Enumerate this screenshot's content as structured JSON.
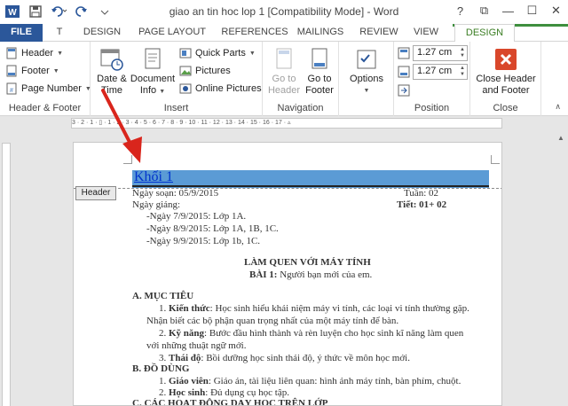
{
  "window": {
    "title": "giao an tin hoc lop 1 [Compatibility Mode] - Word",
    "help": "?",
    "restore": "⧉",
    "minimize": "—",
    "maximize": "☐",
    "close": "✕"
  },
  "tabs": {
    "file": "FILE",
    "t": "T",
    "design": "DESIGN",
    "page_layout": "PAGE LAYOUT",
    "references": "REFERENCES",
    "mailings": "MAILINGS",
    "review": "REVIEW",
    "view": "VIEW",
    "hf_design": "DESIGN"
  },
  "ribbon": {
    "header_footer": {
      "header": "Header",
      "footer": "Footer",
      "page_number": "Page Number",
      "label": "Header & Footer"
    },
    "insert": {
      "date_time_1": "Date &",
      "date_time_2": "Time",
      "doc_info_1": "Document",
      "doc_info_2": "Info",
      "quick_parts": "Quick Parts",
      "pictures": "Pictures",
      "online_pictures": "Online Pictures",
      "label": "Insert"
    },
    "navigation": {
      "goto_header_1": "Go to",
      "goto_header_2": "Header",
      "goto_footer_1": "Go to",
      "goto_footer_2": "Footer",
      "label": "Navigation"
    },
    "options": {
      "options": "Options"
    },
    "position": {
      "header_pos": "1.27 cm",
      "footer_pos": "1.27 cm",
      "label": "Position"
    },
    "close": {
      "close_1": "Close Header",
      "close_2": "and Footer",
      "label": "Close"
    }
  },
  "ruler": {
    "ticks": "3 · 2 · 1 · ▯ · 1 · 2 · 3 · 4 · 5 · 6 · 7 · 8 · 9 · 10 · 11 · 12 · 13 · 14 · 15 · 16 · 17 · ▵"
  },
  "doc": {
    "header_text": "Khối 1",
    "header_tag": "Header",
    "ngay_soan": "Ngày soạn: 05/9/2015",
    "tuan": "Tuần: 02",
    "ngay_giang": "Ngày giảng:",
    "tiet": "Tiết: 01+ 02",
    "ngay1": "-Ngày 7/9/2015: Lớp 1A.",
    "ngay2": "-Ngày 8/9/2015: Lớp 1A, 1B, 1C.",
    "ngay3": "-Ngày 9/9/2015: Lớp 1b, 1C.",
    "lam_quen": "LÀM QUEN VỚI MÁY TÍNH",
    "bai1_label": "BÀI 1:",
    "bai1_text": " Người bạn mới của em.",
    "a_muc_tieu": "A. MỤC TIÊU",
    "kt_num": "1.",
    "kt_label": "Kiến thức",
    "kt_text": ": Học sinh hiểu khái niệm máy vi tính, các loại vi tính thường gặp.",
    "kt_text2": "Nhận biết các bộ phận quan trọng nhất của một máy tính để bàn.",
    "kn_num": "2.",
    "kn_label": "Kỹ năng",
    "kn_text": ": Bước đầu hình thành và rèn luyện cho học sinh kĩ năng làm quen",
    "kn_text2": "với những thuật ngữ mới.",
    "td_num": "3.",
    "td_label": "Thái độ",
    "td_text": ": Bồi dưỡng học sinh thái độ, ý thức về môn học mới.",
    "b_do_dung": "B. ĐỒ DÙNG",
    "gv_num": "1.",
    "gv_label": "Giáo viên",
    "gv_text": ": Giáo án, tài liệu liên quan: hình ảnh máy tính, bàn phím, chuột.",
    "hs_num": "2.",
    "hs_label": "Học sinh",
    "hs_text": ": Đủ dụng cụ học tập.",
    "c_hoat_dong": "C. CÁC HOẠT ĐỘNG DẠY HỌC TRÊN LỚP"
  }
}
